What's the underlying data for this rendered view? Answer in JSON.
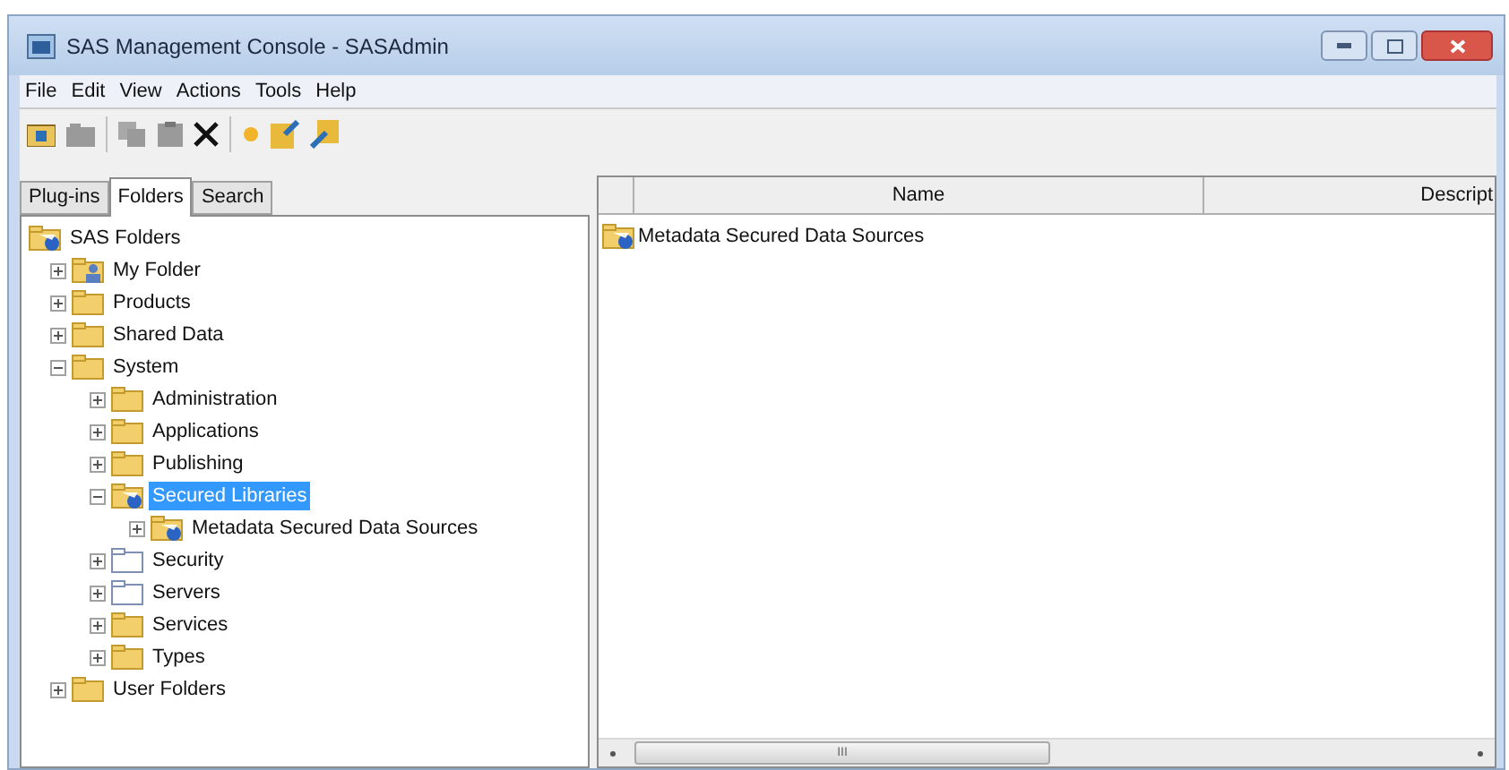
{
  "window": {
    "title": "SAS Management Console - SASAdmin"
  },
  "menu": [
    "File",
    "Edit",
    "View",
    "Actions",
    "Tools",
    "Help"
  ],
  "tabs": [
    {
      "label": "Plug-ins",
      "selected": false
    },
    {
      "label": "Folders",
      "selected": true
    },
    {
      "label": "Search",
      "selected": false
    }
  ],
  "tree": [
    {
      "label": "SAS Folders",
      "kind": "secured",
      "selected": false,
      "children": [
        {
          "label": "My Folder",
          "kind": "user",
          "expanded": false,
          "selected": false
        },
        {
          "label": "Products",
          "kind": "folder",
          "expanded": false,
          "selected": false
        },
        {
          "label": "Shared Data",
          "kind": "folder",
          "expanded": false,
          "selected": false
        },
        {
          "label": "System",
          "kind": "folder",
          "expanded": true,
          "selected": false,
          "children": [
            {
              "label": "Administration",
              "kind": "folder",
              "expanded": false,
              "selected": false
            },
            {
              "label": "Applications",
              "kind": "folder",
              "expanded": false,
              "selected": false
            },
            {
              "label": "Publishing",
              "kind": "folder",
              "expanded": false,
              "selected": false
            },
            {
              "label": "Secured Libraries",
              "kind": "secured",
              "expanded": true,
              "selected": true,
              "children": [
                {
                  "label": "Metadata Secured Data Sources",
                  "kind": "secured",
                  "expanded": false,
                  "selected": false
                }
              ]
            },
            {
              "label": "Security",
              "kind": "empty",
              "expanded": false,
              "selected": false
            },
            {
              "label": "Servers",
              "kind": "empty",
              "expanded": false,
              "selected": false
            },
            {
              "label": "Services",
              "kind": "folder",
              "expanded": false,
              "selected": false
            },
            {
              "label": "Types",
              "kind": "folder",
              "expanded": false,
              "selected": false
            }
          ]
        },
        {
          "label": "User Folders",
          "kind": "folder",
          "expanded": false,
          "selected": false
        }
      ]
    }
  ],
  "table": {
    "columns": [
      "Name",
      "Descript"
    ],
    "rows": [
      {
        "name": "Metadata Secured Data Sources",
        "kind": "secured"
      }
    ]
  },
  "scrollbar_grip": "III"
}
